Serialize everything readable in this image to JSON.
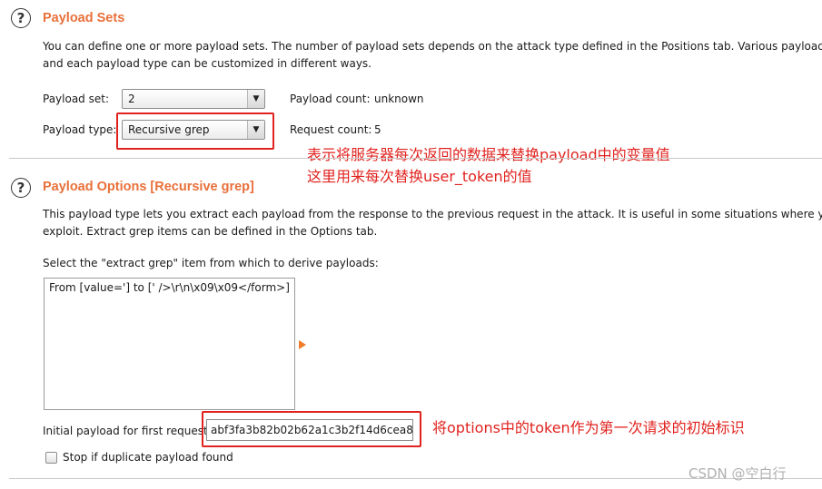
{
  "payload_sets": {
    "title": "Payload Sets",
    "desc_line1": "You can define one or more payload sets. The number of payload sets depends on the attack type defined in the Positions tab. Various payload types",
    "desc_line2": "and each payload type can be customized in different ways.",
    "payload_set_label": "Payload set:",
    "payload_set_value": "2",
    "payload_count_label": "Payload count:",
    "payload_count_value": "unknown",
    "payload_type_label": "Payload type:",
    "payload_type_value": "Recursive grep",
    "request_count_label": "Request count:",
    "request_count_value": "5"
  },
  "annotations": {
    "note1_line1": "表示将服务器每次返回的数据来替换payload中的变量值",
    "note1_line2": "这里用来每次替换user_token的值",
    "note2": "将options中的token作为第一次请求的初始标识"
  },
  "payload_options": {
    "title": "Payload Options [Recursive grep]",
    "desc_line1": "This payload type lets you extract each payload from the response to the previous request in the attack. It is useful in some situations where you nee",
    "desc_line2": "exploit. Extract grep items can be defined in the Options tab.",
    "select_label": "Select the \"extract grep\" item from which to derive payloads:",
    "grep_items": [
      "From [value='] to [' />\\r\\n\\x09\\x09</form>]"
    ],
    "initial_payload_label": "Initial payload for first request:",
    "initial_payload_value": "abf3fa3b82b02b62a1c3b2f14d6cea8a",
    "stop_duplicate_label": "Stop if duplicate payload found"
  },
  "watermark": "CSDN @空白行"
}
